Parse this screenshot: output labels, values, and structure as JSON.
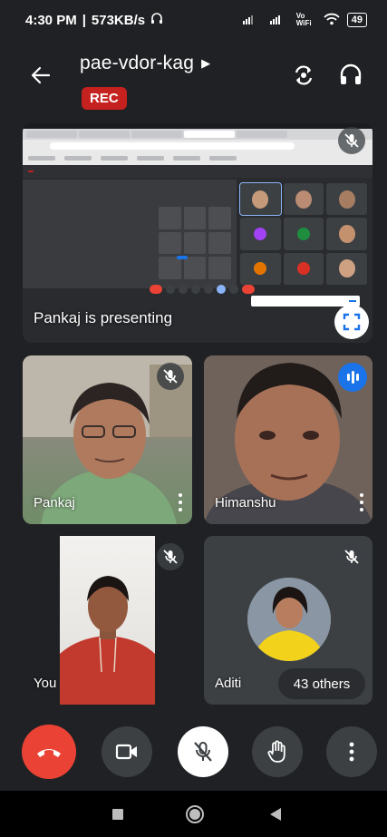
{
  "status_bar": {
    "time": "4:30 PM",
    "speed": "573KB/s",
    "network": "Vo WiFi",
    "battery": "49"
  },
  "header": {
    "meeting_code": "pae-vdor-kag",
    "rec_label": "REC"
  },
  "presentation": {
    "label": "Pankaj is presenting"
  },
  "participants": [
    {
      "name": "Pankaj",
      "muted": true,
      "speaking": false
    },
    {
      "name": "Himanshu",
      "muted": false,
      "speaking": true
    },
    {
      "name": "You",
      "muted": true,
      "speaking": false
    },
    {
      "name": "Aditi",
      "muted": true,
      "speaking": false
    }
  ],
  "others_count_label": "43 others",
  "colors": {
    "background": "#202124",
    "tile": "#3c4043",
    "end_call": "#ea4335",
    "rec": "#c5221f",
    "speaking": "#1a73e8"
  },
  "icons": {
    "back": "arrow-left-icon",
    "switch_camera": "switch-camera-icon",
    "audio_output": "headphones-icon",
    "end_call": "hang-up-icon",
    "camera": "video-camera-icon",
    "mic": "mic-off-icon",
    "raise_hand": "raise-hand-icon",
    "more": "more-vertical-icon",
    "fullscreen": "fullscreen-icon"
  }
}
